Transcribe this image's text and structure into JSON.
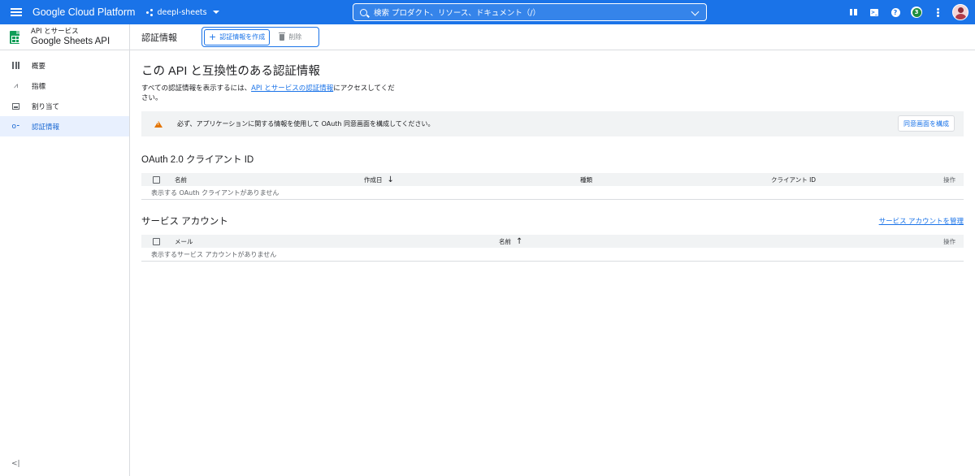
{
  "topbar": {
    "brand": "Google Cloud Platform",
    "project": "deepl-sheets",
    "search_placeholder": "検索  プロダクト、リソース、ドキュメント（/）",
    "notifications_count": "3"
  },
  "sidebar": {
    "api_category": "API とサービス",
    "api_name": "Google Sheets API",
    "items": [
      {
        "label": "概要",
        "icon": "dashboard-icon"
      },
      {
        "label": "指標",
        "icon": "metrics-icon"
      },
      {
        "label": "割り当て",
        "icon": "quota-icon"
      },
      {
        "label": "認証情報",
        "icon": "key-icon",
        "active": true
      }
    ],
    "collapse_label": "<|"
  },
  "header": {
    "title": "認証情報",
    "create_label": "認証情報を作成",
    "delete_label": "削除"
  },
  "main": {
    "heading": "この API と互換性のある認証情報",
    "desc_pre": "すべての認証情報を表示するには、",
    "desc_link": "API とサービスの認証情報",
    "desc_post": "にアクセスしてください。",
    "warning_text": "必ず、アプリケーションに関する情報を使用して OAuth 同意画面を構成してください。",
    "consent_button": "同意画面を構成",
    "oauth": {
      "title": "OAuth 2.0 クライアント ID",
      "columns": [
        "名前",
        "作成日",
        "種類",
        "クライアント ID",
        "操作"
      ],
      "empty": "表示する OAuth クライアントがありません"
    },
    "service": {
      "title": "サービス アカウント",
      "manage_link": "サービス アカウントを管理",
      "columns": [
        "メール",
        "名前",
        "操作"
      ],
      "empty": "表示するサービス アカウントがありません"
    }
  },
  "colors": {
    "accent": "#1a73e8",
    "warning": "#e37400",
    "active_bg": "#e8f0fe"
  }
}
